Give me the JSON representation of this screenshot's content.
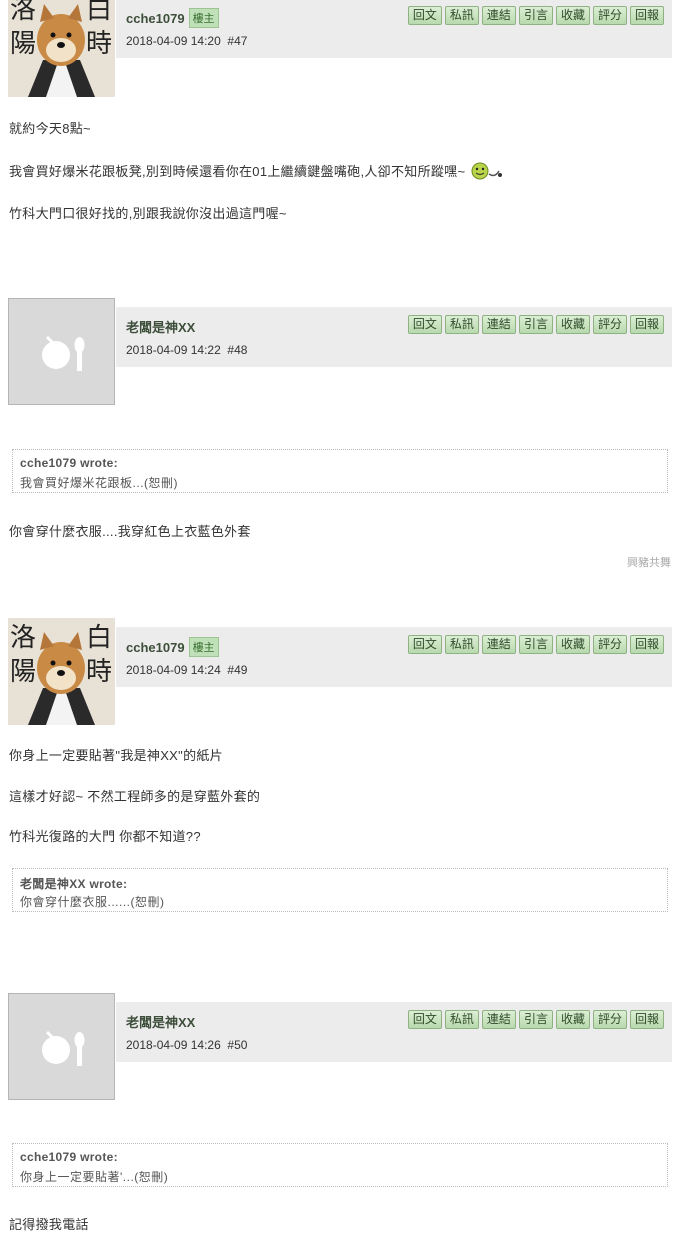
{
  "buttons": [
    "回文",
    "私訊",
    "連結",
    "引言",
    "收藏",
    "評分",
    "回報"
  ],
  "owner_tag": "樓主",
  "posts": [
    {
      "username": "cche1079",
      "datetime": "2018-04-09 14:20",
      "floor": "#47",
      "lines": [
        "就約今天8點~",
        "我會買好爆米花跟板凳,別到時候還看你在01上繼續鍵盤嘴砲,人卻不知所蹤嘿~",
        "竹科大門口很好找的,別跟我說你沒出過這門喔~"
      ]
    },
    {
      "username": "老闆是神XX",
      "datetime": "2018-04-09 14:22",
      "floor": "#48",
      "quote_author": "cche1079 wrote:",
      "quote_text": "我會買好爆米花跟板...(恕刪)",
      "lines": [
        "你會穿什麼衣服....我穿紅色上衣藍色外套"
      ],
      "signature": "興豬共舞"
    },
    {
      "username": "cche1079",
      "datetime": "2018-04-09 14:24",
      "floor": "#49",
      "lines": [
        "你身上一定要貼著\"我是神XX\"的紙片",
        "這樣才好認~ 不然工程師多的是穿藍外套的",
        "竹科光復路的大門 你都不知道??"
      ],
      "quote_author": "老闆是神XX wrote:",
      "quote_text": "你會穿什麼衣服......(恕刪)"
    },
    {
      "username": "老闆是神XX",
      "datetime": "2018-04-09 14:26",
      "floor": "#50",
      "quote_author": "cche1079 wrote:",
      "quote_text": "你身上一定要貼著'...(恕刪)",
      "lines": [
        "記得撥我電話"
      ]
    }
  ]
}
